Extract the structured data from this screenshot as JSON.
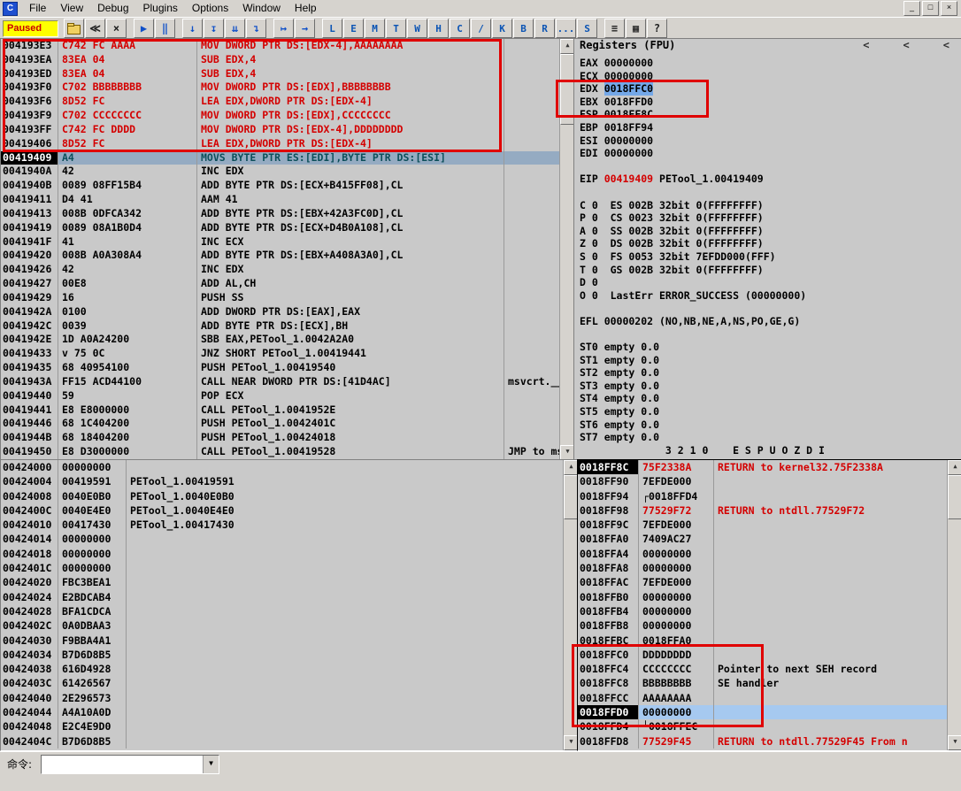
{
  "window": {
    "icon_label": "C",
    "menus": [
      "File",
      "View",
      "Debug",
      "Plugins",
      "Options",
      "Window",
      "Help"
    ],
    "window_buttons": [
      {
        "name": "minimize-button",
        "glyph": "_"
      },
      {
        "name": "restore-button",
        "glyph": "□"
      },
      {
        "name": "close-button",
        "glyph": "×"
      }
    ]
  },
  "toolbar": {
    "status": "Paused",
    "buttons": [
      {
        "name": "open-file-button",
        "glyph": "folder"
      },
      {
        "name": "restart-button",
        "glyph": "≪"
      },
      {
        "name": "close-program-button",
        "glyph": "×"
      },
      {
        "sep": true
      },
      {
        "name": "run-button",
        "glyph": "▶",
        "color": "#1050C8"
      },
      {
        "name": "pause-button",
        "glyph": "‖",
        "color": "#1050C8"
      },
      {
        "sep": true
      },
      {
        "name": "step-into-button",
        "glyph": "↓",
        "color": "#1050C8"
      },
      {
        "name": "step-over-button",
        "glyph": "↧",
        "color": "#1050C8"
      },
      {
        "name": "animate-into-button",
        "glyph": "⇊",
        "color": "#1050C8"
      },
      {
        "name": "animate-over-button",
        "glyph": "↴",
        "color": "#1050C8"
      },
      {
        "sep": true
      },
      {
        "name": "execute-till-return-button",
        "glyph": "↦",
        "color": "#1050C8"
      },
      {
        "name": "go-to-address-button",
        "glyph": "→",
        "color": "#1050C8"
      },
      {
        "sep": true
      }
    ],
    "view_buttons": [
      {
        "label": "L",
        "name": "view-log-button"
      },
      {
        "label": "E",
        "name": "view-executables-button"
      },
      {
        "label": "M",
        "name": "view-memory-button"
      },
      {
        "label": "T",
        "name": "view-threads-button"
      },
      {
        "label": "W",
        "name": "view-windows-button"
      },
      {
        "label": "H",
        "name": "view-handles-button"
      },
      {
        "label": "C",
        "name": "view-cpu-button"
      },
      {
        "label": "/",
        "name": "view-patches-button"
      },
      {
        "label": "K",
        "name": "view-call-stack-button"
      },
      {
        "label": "B",
        "name": "view-breakpoints-button"
      },
      {
        "label": "R",
        "name": "view-references-button"
      },
      {
        "label": "...",
        "name": "view-run-trace-button"
      },
      {
        "label": "S",
        "name": "view-source-button"
      }
    ],
    "tail_buttons": [
      {
        "name": "debugging-options-button",
        "glyph": "≡"
      },
      {
        "name": "appearance-button",
        "glyph": "▦"
      },
      {
        "name": "help-button",
        "glyph": "?"
      }
    ]
  },
  "disassembly": {
    "rows": [
      {
        "a": "004193E3",
        "b": "C742 FC AAAA",
        "i": "MOV DWORD PTR DS:[EDX-4],AAAAAAAA",
        "mod": true
      },
      {
        "a": "004193EA",
        "b": "83EA 04",
        "i": "SUB EDX,4",
        "mod": true
      },
      {
        "a": "004193ED",
        "b": "83EA 04",
        "i": "SUB EDX,4",
        "mod": true
      },
      {
        "a": "004193F0",
        "b": "C702 BBBBBBBB",
        "i": "MOV DWORD PTR DS:[EDX],BBBBBBBB",
        "mod": true
      },
      {
        "a": "004193F6",
        "b": "8D52 FC",
        "i": "LEA EDX,DWORD PTR DS:[EDX-4]",
        "mod": true
      },
      {
        "a": "004193F9",
        "b": "C702 CCCCCCCC",
        "i": "MOV DWORD PTR DS:[EDX],CCCCCCCC",
        "mod": true
      },
      {
        "a": "004193FF",
        "b": "C742 FC DDDD",
        "i": "MOV DWORD PTR DS:[EDX-4],DDDDDDDD",
        "mod": true
      },
      {
        "a": "00419406",
        "b": "8D52 FC",
        "i": "LEA EDX,DWORD PTR DS:[EDX-4]",
        "mod": true
      },
      {
        "a": "00419409",
        "b": "A4",
        "i": "MOVS BYTE PTR ES:[EDI],BYTE PTR DS:[ESI]",
        "sel": true
      },
      {
        "a": "0041940A",
        "b": "42",
        "i": "INC EDX"
      },
      {
        "a": "0041940B",
        "b": "0089 08FF15B4",
        "i": "ADD BYTE PTR DS:[ECX+B415FF08],CL"
      },
      {
        "a": "00419411",
        "b": "D4 41",
        "i": "AAM 41"
      },
      {
        "a": "00419413",
        "b": "008B 0DFCA342",
        "i": "ADD BYTE PTR DS:[EBX+42A3FC0D],CL"
      },
      {
        "a": "00419419",
        "b": "0089 08A1B0D4",
        "i": "ADD BYTE PTR DS:[ECX+D4B0A108],CL"
      },
      {
        "a": "0041941F",
        "b": "41",
        "i": "INC ECX"
      },
      {
        "a": "00419420",
        "b": "008B A0A308A4",
        "i": "ADD BYTE PTR DS:[EBX+A408A3A0],CL"
      },
      {
        "a": "00419426",
        "b": "42",
        "i": "INC EDX"
      },
      {
        "a": "00419427",
        "b": "00E8",
        "i": "ADD AL,CH"
      },
      {
        "a": "00419429",
        "b": "16",
        "i": "PUSH SS"
      },
      {
        "a": "0041942A",
        "b": "0100",
        "i": "ADD DWORD PTR DS:[EAX],EAX"
      },
      {
        "a": "0041942C",
        "b": "0039",
        "i": "ADD BYTE PTR DS:[ECX],BH"
      },
      {
        "a": "0041942E",
        "b": "1D A0A24200",
        "i": "SBB EAX,PETool_1.0042A2A0"
      },
      {
        "a": "00419433",
        "b": "75 0C",
        "i": "JNZ SHORT PETool_1.00419441",
        "mark": "v"
      },
      {
        "a": "00419435",
        "b": "68 40954100",
        "i": "PUSH PETool_1.00419540"
      },
      {
        "a": "0041943A",
        "b": "FF15 ACD44100",
        "i": "CALL NEAR DWORD PTR DS:[41D4AC]",
        "c": "msvcrt.__se"
      },
      {
        "a": "00419440",
        "b": "59",
        "i": "POP ECX"
      },
      {
        "a": "00419441",
        "b": "E8 E8000000",
        "i": "CALL PETool_1.0041952E"
      },
      {
        "a": "00419446",
        "b": "68 1C404200",
        "i": "PUSH PETool_1.0042401C"
      },
      {
        "a": "0041944B",
        "b": "68 18404200",
        "i": "PUSH PETool_1.00424018"
      },
      {
        "a": "00419450",
        "b": "E8 D3000000",
        "i": "CALL PETool_1.00419528",
        "c": "JMP to msvc"
      }
    ]
  },
  "registers": {
    "title": "Registers (FPU)",
    "collapse_chevrons": [
      "<",
      "<",
      "<"
    ],
    "rows": [
      {
        "p": [
          {
            "t": "EAX "
          },
          {
            "t": "00000000"
          }
        ]
      },
      {
        "p": [
          {
            "t": "ECX "
          },
          {
            "t": "00000000"
          }
        ]
      },
      {
        "p": [
          {
            "t": "EDX "
          },
          {
            "t": "0018FFC0",
            "c": "hl"
          }
        ]
      },
      {
        "p": [
          {
            "t": "EBX "
          },
          {
            "t": "0018FFD0"
          }
        ]
      },
      {
        "p": [
          {
            "t": "ESP "
          },
          {
            "t": "0018FF8C"
          }
        ]
      },
      {
        "p": [
          {
            "t": "EBP "
          },
          {
            "t": "0018FF94"
          }
        ]
      },
      {
        "p": [
          {
            "t": "ESI "
          },
          {
            "t": "00000000"
          }
        ]
      },
      {
        "p": [
          {
            "t": "EDI "
          },
          {
            "t": "00000000"
          }
        ]
      },
      {
        "p": []
      },
      {
        "p": [
          {
            "t": "EIP "
          },
          {
            "t": "00419409",
            "c": "red"
          },
          {
            "t": " PETool_1.00419409"
          }
        ]
      },
      {
        "p": []
      },
      {
        "p": [
          {
            "t": "C 0  "
          },
          {
            "t": "ES 002B 32bit 0(FFFFFFFF)"
          }
        ]
      },
      {
        "p": [
          {
            "t": "P 0  "
          },
          {
            "t": "CS 0023 32bit 0(FFFFFFFF)"
          }
        ]
      },
      {
        "p": [
          {
            "t": "A 0  "
          },
          {
            "t": "SS 002B 32bit 0(FFFFFFFF)"
          }
        ]
      },
      {
        "p": [
          {
            "t": "Z 0  "
          },
          {
            "t": "DS 002B 32bit 0(FFFFFFFF)"
          }
        ]
      },
      {
        "p": [
          {
            "t": "S 0  "
          },
          {
            "t": "FS 0053 32bit 7EFDD000(FFF)"
          }
        ]
      },
      {
        "p": [
          {
            "t": "T 0  "
          },
          {
            "t": "GS 002B 32bit 0(FFFFFFFF)"
          }
        ]
      },
      {
        "p": [
          {
            "t": "D 0"
          }
        ]
      },
      {
        "p": [
          {
            "t": "O 0  "
          },
          {
            "t": "LastErr ERROR_SUCCESS (00000000)"
          }
        ]
      },
      {
        "p": []
      },
      {
        "p": [
          {
            "t": "EFL 00000202 (NO,NB,NE,A,NS,PO,GE,G)"
          }
        ]
      },
      {
        "p": []
      },
      {
        "p": [
          {
            "t": "ST0 empty 0.0"
          }
        ]
      },
      {
        "p": [
          {
            "t": "ST1 empty 0.0"
          }
        ]
      },
      {
        "p": [
          {
            "t": "ST2 empty 0.0"
          }
        ]
      },
      {
        "p": [
          {
            "t": "ST3 empty 0.0"
          }
        ]
      },
      {
        "p": [
          {
            "t": "ST4 empty 0.0"
          }
        ]
      },
      {
        "p": [
          {
            "t": "ST5 empty 0.0"
          }
        ]
      },
      {
        "p": [
          {
            "t": "ST6 empty 0.0"
          }
        ]
      },
      {
        "p": [
          {
            "t": "ST7 empty 0.0"
          }
        ]
      },
      {
        "p": [
          {
            "t": "              3 2 1 0    E S P U O Z D I"
          }
        ]
      }
    ]
  },
  "dump": {
    "rows": [
      {
        "addr": "00424000",
        "val": "00000000"
      },
      {
        "addr": "00424004",
        "val": "00419591",
        "com": "PETool_1.00419591"
      },
      {
        "addr": "00424008",
        "val": "0040E0B0",
        "com": "PETool_1.0040E0B0"
      },
      {
        "addr": "0042400C",
        "val": "0040E4E0",
        "com": "PETool_1.0040E4E0"
      },
      {
        "addr": "00424010",
        "val": "00417430",
        "com": "PETool_1.00417430"
      },
      {
        "addr": "00424014",
        "val": "00000000"
      },
      {
        "addr": "00424018",
        "val": "00000000"
      },
      {
        "addr": "0042401C",
        "val": "00000000"
      },
      {
        "addr": "00424020",
        "val": "FBC3BEA1"
      },
      {
        "addr": "00424024",
        "val": "E2BDCAB4"
      },
      {
        "addr": "00424028",
        "val": "BFA1CDCA"
      },
      {
        "addr": "0042402C",
        "val": "0A0DBAA3"
      },
      {
        "addr": "00424030",
        "val": "F9BBA4A1"
      },
      {
        "addr": "00424034",
        "val": "B7D6D8B5"
      },
      {
        "addr": "00424038",
        "val": "616D4928"
      },
      {
        "addr": "0042403C",
        "val": "61426567"
      },
      {
        "addr": "00424040",
        "val": "2E296573"
      },
      {
        "addr": "00424044",
        "val": "A4A10A0D"
      },
      {
        "addr": "00424048",
        "val": "E2C4E9D0"
      },
      {
        "addr": "0042404C",
        "val": "B7D6D8B5"
      }
    ]
  },
  "stack": {
    "rows": [
      {
        "addr": "0018FF8C",
        "val": "75F2338A",
        "com": "RETURN to kernel32.75F2338A",
        "addr_black": true,
        "red": true
      },
      {
        "addr": "0018FF90",
        "val": "7EFDE000"
      },
      {
        "addr": "0018FF94",
        "val": "0018FFD4",
        "prefix": "┌"
      },
      {
        "addr": "0018FF98",
        "val": "77529F72",
        "com": "RETURN to ntdll.77529F72",
        "red": true
      },
      {
        "addr": "0018FF9C",
        "val": "7EFDE000"
      },
      {
        "addr": "0018FFA0",
        "val": "7409AC27"
      },
      {
        "addr": "0018FFA4",
        "val": "00000000"
      },
      {
        "addr": "0018FFA8",
        "val": "00000000"
      },
      {
        "addr": "0018FFAC",
        "val": "7EFDE000"
      },
      {
        "addr": "0018FFB0",
        "val": "00000000"
      },
      {
        "addr": "0018FFB4",
        "val": "00000000"
      },
      {
        "addr": "0018FFB8",
        "val": "00000000"
      },
      {
        "addr": "0018FFBC",
        "val": "0018FFA0"
      },
      {
        "addr": "0018FFC0",
        "val": "DDDDDDDD"
      },
      {
        "addr": "0018FFC4",
        "val": "CCCCCCCC",
        "com": "Pointer to next SEH record"
      },
      {
        "addr": "0018FFC8",
        "val": "BBBBBBBB",
        "com": "SE handler"
      },
      {
        "addr": "0018FFCC",
        "val": "AAAAAAAA"
      },
      {
        "addr": "0018FFD0",
        "val": "00000000",
        "addr_black": true,
        "sel": true
      },
      {
        "addr": "0018FFD4",
        "val": "0018FFEC",
        "prefix": "└"
      },
      {
        "addr": "0018FFD8",
        "val": "77529F45",
        "com": "RETURN to ntdll.77529F45 From n",
        "red": true
      }
    ]
  },
  "command_bar": {
    "label": "命令:",
    "value": ""
  },
  "icons": {
    "scroll_up": "▲",
    "scroll_down": "▼",
    "combo_arrow": "▼"
  },
  "colors": {
    "annotation_box": "#E00000",
    "modified_code_text": "#D40000",
    "selection_blue": "#74A8E8"
  }
}
